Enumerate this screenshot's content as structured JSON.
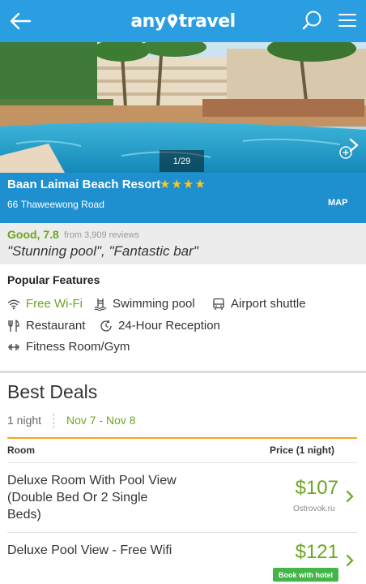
{
  "header": {
    "logo_left": "any",
    "logo_right": "travel",
    "accent": "#2a9ee0"
  },
  "gallery": {
    "counter": "1/29"
  },
  "hotel": {
    "name": "Baan Laimai Beach Resort",
    "stars": "★★★★",
    "address": "66 Thaweewong Road",
    "map_label": "MAP",
    "bar_color": "#1e8fcf"
  },
  "rating": {
    "score": "Good, 7.8",
    "count": "from 3,909 reviews",
    "quote": "\"Stunning pool\", \"Fantastic bar\""
  },
  "features": {
    "title": "Popular Features",
    "items": [
      {
        "label": "Free Wi-Fi",
        "icon": "wifi-icon"
      },
      {
        "label": "Swimming pool",
        "icon": "pool-icon"
      },
      {
        "label": "Airport shuttle",
        "icon": "bus-icon"
      },
      {
        "label": "Restaurant",
        "icon": "restaurant-icon"
      },
      {
        "label": "24-Hour Reception",
        "icon": "clock-icon"
      },
      {
        "label": "Fitness Room/Gym",
        "icon": "dumbbell-icon"
      }
    ]
  },
  "deals": {
    "title": "Best Deals",
    "nights": "1 night",
    "dates": "Nov 7 - Nov 8",
    "col_room": "Room",
    "col_price": "Price (1 night)",
    "rows": [
      {
        "room": "Deluxe Room With Pool View (Double Bed Or 2 Single Beds)",
        "price": "$107",
        "provider": "Ostrovok.ru"
      },
      {
        "room": "Deluxe Pool View - Free Wifi",
        "price": "$121",
        "badge": "Book with hotel"
      }
    ]
  }
}
